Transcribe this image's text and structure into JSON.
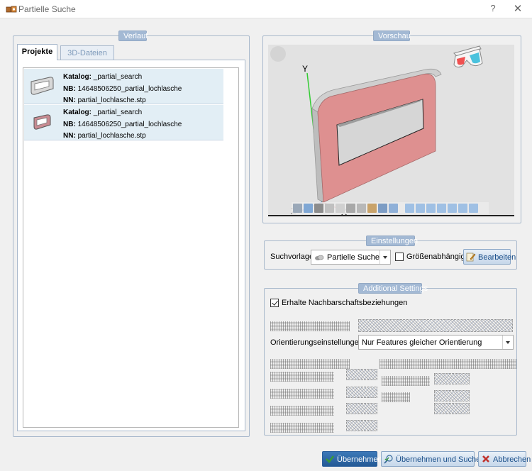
{
  "window": {
    "title": "Partielle Suche",
    "help_label": "?",
    "close_label": "✕"
  },
  "verlauf": {
    "group_title": "Verlauf",
    "tabs": [
      {
        "label": "Projekte",
        "active": true
      },
      {
        "label": "3D-Dateien",
        "active": false
      }
    ],
    "projects": [
      {
        "katalog_key": "Katalog:",
        "katalog_value": "_partial_search",
        "nb_key": "NB:",
        "nb_value": "14648506250_partial_lochlasche",
        "nn_key": "NN:",
        "nn_value": "partial_lochlasche.stp",
        "thumb_color": "#d8d8d8"
      },
      {
        "katalog_key": "Katalog:",
        "katalog_value": "_partial_search",
        "nb_key": "NB:",
        "nb_value": "14648506250_partial_lochlasche",
        "nn_key": "NN:",
        "nn_value": "partial_lochlasche.stp",
        "thumb_color": "#c98b92"
      }
    ]
  },
  "vorschau": {
    "group_title": "Vorschau",
    "axis_y": "Y",
    "axis_z": "Z",
    "axis_x": "X",
    "part_color": "#de9090",
    "toolbar_icons": [
      "cube-icon",
      "view-icon",
      "box-icon",
      "arrow-icon",
      "light-icon",
      "filter-icon",
      "grid-icon",
      "sphere-icon",
      "gear-icon",
      "frame-icon",
      "view-front-icon",
      "view-back-icon",
      "view-left-icon",
      "view-right-icon",
      "view-top-icon",
      "view-bottom-icon",
      "view-iso-icon"
    ]
  },
  "einstellungen": {
    "group_title": "Einstellungen",
    "suchvorlage_label": "Suchvorlage:",
    "suchvorlage_value": "Partielle Suche",
    "groessen_label": "Größenabhängig",
    "groessen_checked": false,
    "bearbeiten_label": "Bearbeiten"
  },
  "additional": {
    "group_title": "Additional Settings",
    "nachbarschaft_label": "Erhalte Nachbarschaftsbeziehungen",
    "nachbarschaft_checked": true,
    "orientierung_label": "Orientierungseinstellungen:",
    "orientierung_value": "Nur Features gleicher Orientierung"
  },
  "footer": {
    "uebernehmen_label": "Übernehmen",
    "uebernehmen_suchen_label": "Übernehmen und Suchen",
    "abbrechen_label": "Abbrechen"
  },
  "colors": {
    "accent": "#a3b9d4",
    "selection": "#e2eef5",
    "ok_green": "#3a9a3a",
    "cancel_red": "#c0302a"
  }
}
